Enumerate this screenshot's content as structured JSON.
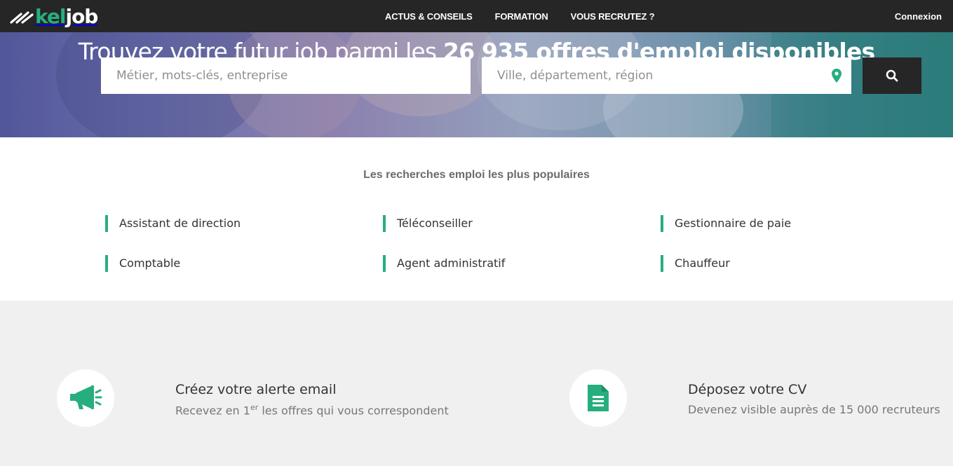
{
  "header": {
    "logo_kel": "kel",
    "logo_job": "job",
    "nav": [
      "ACTUS & CONSEILS",
      "FORMATION",
      "VOUS RECRUTEZ ?"
    ],
    "login": "Connexion"
  },
  "hero": {
    "title_light": "Trouvez votre futur job parmi les ",
    "title_bold": "26 935 offres d'emploi disponibles",
    "what_placeholder": "Métier, mots-clés, entreprise",
    "where_placeholder": "Ville, département, région"
  },
  "popular": {
    "title": "Les recherches emploi les plus populaires",
    "items": [
      "Assistant de direction",
      "Téléconseiller",
      "Gestionnaire de paie",
      "Comptable",
      "Agent administratif",
      "Chauffeur"
    ]
  },
  "features": {
    "alert_title": "Créez votre alerte email",
    "alert_sub_pre": "Recevez en 1",
    "alert_sub_sup": "er",
    "alert_sub_post": " les offres qui vous correspondent",
    "cv_title": "Déposez votre CV",
    "cv_sub": "Devenez visible auprès de 15 000 recruteurs"
  },
  "colors": {
    "accent": "#27ae7e",
    "dark": "#262626"
  },
  "icons": [
    "search-icon",
    "location-pin-icon",
    "megaphone-icon",
    "document-icon"
  ]
}
